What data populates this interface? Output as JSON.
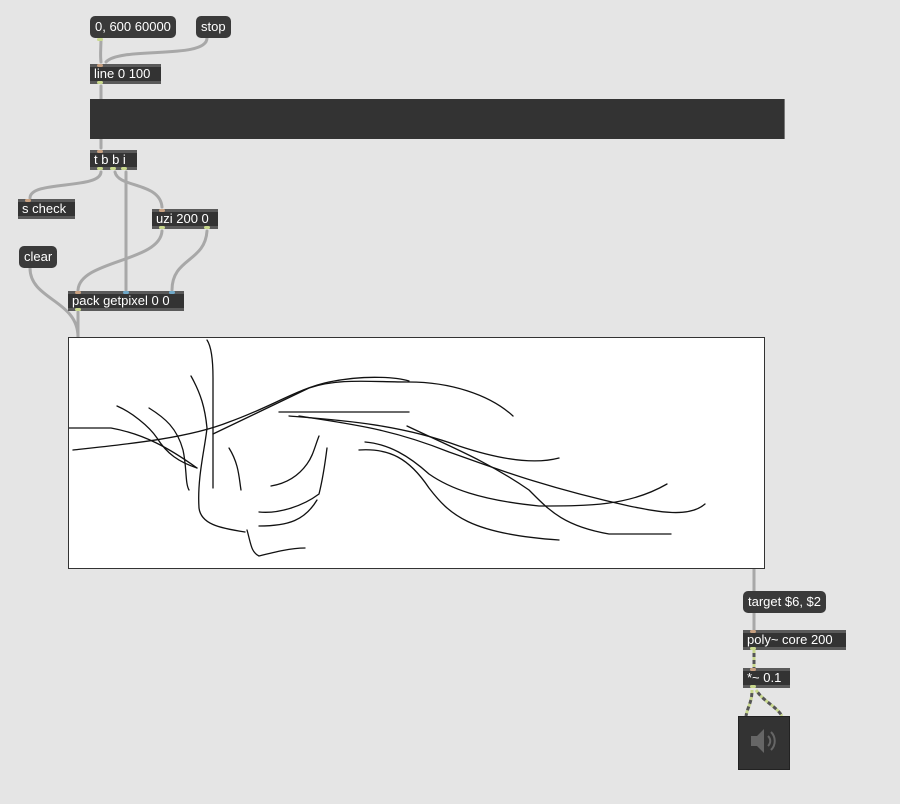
{
  "patch": {
    "msg_ramp": "0, 600 60000",
    "msg_stop": "stop",
    "obj_line": "line 0 100",
    "obj_trigger": "t b b i",
    "obj_send": "s check",
    "obj_uzi": "uzi 200 0",
    "msg_clear": "clear",
    "obj_pack": "pack getpixel 0 0",
    "msg_target": "target $6, $2",
    "obj_poly": "poly~ core 200",
    "obj_mul": "*~ 0.1"
  },
  "icons": {
    "dac": "speaker-icon"
  },
  "colors": {
    "background": "#e5e5e5",
    "object": "#333333",
    "cord": "#a9a9a9",
    "signal_cord": "#c8d88c"
  }
}
